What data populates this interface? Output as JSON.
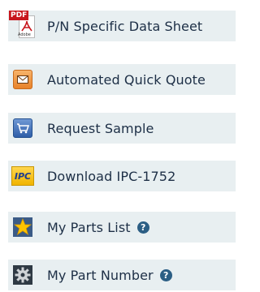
{
  "items": [
    {
      "label": "P/N Specific Data Sheet",
      "icon": "pdf-icon"
    },
    {
      "label": "Automated Quick Quote",
      "icon": "mail-icon"
    },
    {
      "label": "Request Sample",
      "icon": "cart-icon"
    },
    {
      "label": "Download IPC-1752",
      "icon": "ipc-icon"
    },
    {
      "label": "My Parts List",
      "icon": "star-icon",
      "help": "?"
    },
    {
      "label": "My Part Number",
      "icon": "gear-icon",
      "help": "?"
    }
  ],
  "pdf_icon": {
    "tag": "PDF",
    "caption": "Adobe"
  },
  "ipc_icon": {
    "text": "IPC"
  },
  "colors": {
    "row_background": "#e8eff1",
    "label_text": "#1d2f46",
    "help_badge": "#2b5e84"
  }
}
